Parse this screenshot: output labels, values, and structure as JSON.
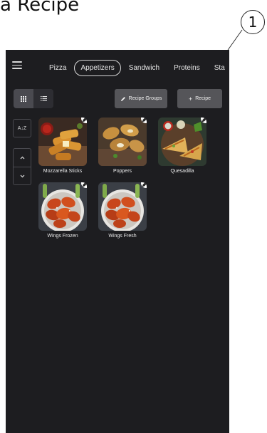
{
  "document": {
    "title": "a Recipe",
    "callout_number": "1"
  },
  "header": {
    "menu_icon": "hamburger-icon",
    "tabs": [
      {
        "label": "Pizza",
        "active": false
      },
      {
        "label": "Appetizers",
        "active": true
      },
      {
        "label": "Sandwich",
        "active": false
      },
      {
        "label": "Proteins",
        "active": false
      },
      {
        "label": "Sta",
        "active": false
      }
    ]
  },
  "toolbar": {
    "grid_view_icon": "grid-icon",
    "list_view_icon": "list-icon",
    "recipe_groups_label": "Recipe Groups",
    "recipe_groups_icon": "pencil-icon",
    "add_recipe_label": "Recipe",
    "add_recipe_icon": "plus-icon"
  },
  "sidebar": {
    "sort_label": "A↓Z",
    "scroll_up_icon": "chevron-up-icon",
    "scroll_down_icon": "chevron-down-icon"
  },
  "recipes": [
    {
      "name": "Mozzarella Sticks",
      "image": "mozzarella-sticks-photo"
    },
    {
      "name": "Poppers",
      "image": "poppers-photo"
    },
    {
      "name": "Quesadilla",
      "image": "quesadilla-photo"
    },
    {
      "name": "Wings Frozen",
      "image": "wings-photo"
    },
    {
      "name": "Wings Fresh",
      "image": "wings-photo"
    }
  ],
  "colors": {
    "background": "#1d1d20",
    "button": "#555559",
    "text": "#ececec"
  }
}
